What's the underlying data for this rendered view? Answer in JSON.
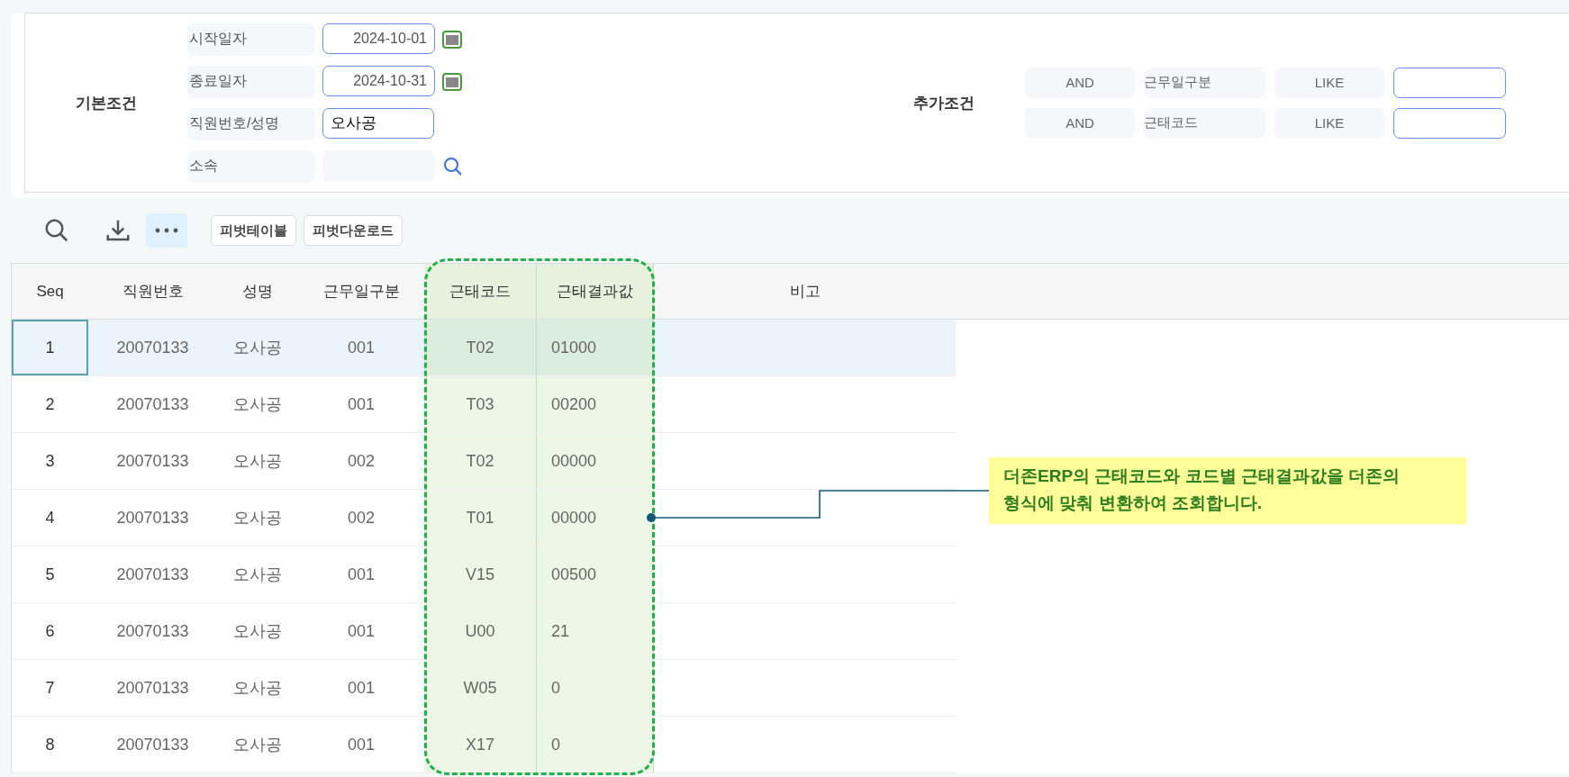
{
  "basic_conditions": {
    "title": "기본조건",
    "fields": [
      {
        "label": "시작일자",
        "value": "2024-10-01",
        "kind": "date"
      },
      {
        "label": "종료일자",
        "value": "2024-10-31",
        "kind": "date"
      },
      {
        "label": "직원번호/성명",
        "value": "오사공",
        "kind": "text"
      },
      {
        "label": "소속",
        "kind": "lookup"
      }
    ]
  },
  "extra_conditions": {
    "title": "추가조건",
    "rows": [
      {
        "operator": "AND",
        "field": "근무일구분",
        "match": "LIKE"
      },
      {
        "operator": "AND",
        "field": "근태코드",
        "match": "LIKE"
      }
    ]
  },
  "toolbar": {
    "buttons": [
      "피벗테이블",
      "피벗다운로드"
    ]
  },
  "table": {
    "columns": [
      {
        "label": "Seq",
        "highlighted": false
      },
      {
        "label": "직원번호",
        "highlighted": false
      },
      {
        "label": "성명",
        "highlighted": false
      },
      {
        "label": "근무일구분",
        "highlighted": false
      },
      {
        "label": "근태코드",
        "highlighted": true
      },
      {
        "label": "근태결과값",
        "highlighted": true
      },
      {
        "label": "비고",
        "highlighted": false
      }
    ],
    "rows": [
      {
        "selected": true,
        "cells": [
          "1",
          "20070133",
          "오사공",
          "001",
          "T02",
          "01000"
        ]
      },
      {
        "selected": false,
        "cells": [
          "2",
          "20070133",
          "오사공",
          "001",
          "T03",
          "00200"
        ]
      },
      {
        "selected": false,
        "cells": [
          "3",
          "20070133",
          "오사공",
          "002",
          "T02",
          "00000"
        ]
      },
      {
        "selected": false,
        "cells": [
          "4",
          "20070133",
          "오사공",
          "002",
          "T01",
          "00000"
        ]
      },
      {
        "selected": false,
        "cells": [
          "5",
          "20070133",
          "오사공",
          "001",
          "V15",
          "00500"
        ]
      },
      {
        "selected": false,
        "cells": [
          "6",
          "20070133",
          "오사공",
          "001",
          "U00",
          "21"
        ]
      },
      {
        "selected": false,
        "cells": [
          "7",
          "20070133",
          "오사공",
          "001",
          "W05",
          "0"
        ]
      },
      {
        "selected": false,
        "cells": [
          "8",
          "20070133",
          "오사공",
          "001",
          "X17",
          "0"
        ]
      }
    ]
  },
  "callout": {
    "text": "더존ERP의 근태코드와 코드별 근태결과값을 더존의 형식에 맞춰 변환하여 조회합니다."
  }
}
